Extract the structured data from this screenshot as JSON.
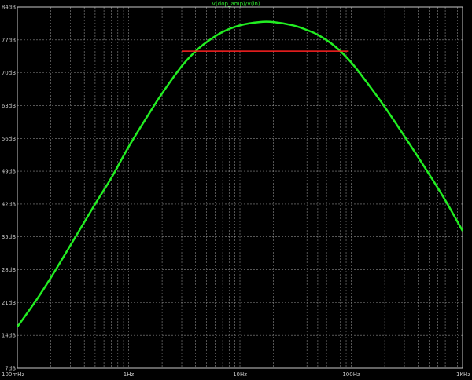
{
  "chart_data": {
    "type": "line",
    "title": "V(dop_amp)/V(in)",
    "x_scale": "log",
    "xlim": [
      0.1,
      1000
    ],
    "ylim": [
      7,
      84
    ],
    "x_ticks": [
      {
        "value": 0.1,
        "label": "100mHz"
      },
      {
        "value": 1,
        "label": "1Hz"
      },
      {
        "value": 10,
        "label": "10Hz"
      },
      {
        "value": 100,
        "label": "100Hz"
      },
      {
        "value": 1000,
        "label": "1KHz"
      }
    ],
    "y_ticks": [
      {
        "value": 84,
        "label": "84dB"
      },
      {
        "value": 77,
        "label": "77dB"
      },
      {
        "value": 70,
        "label": "70dB"
      },
      {
        "value": 63,
        "label": "63dB"
      },
      {
        "value": 56,
        "label": "56dB"
      },
      {
        "value": 49,
        "label": "49dB"
      },
      {
        "value": 42,
        "label": "42dB"
      },
      {
        "value": 35,
        "label": "35dB"
      },
      {
        "value": 28,
        "label": "28dB"
      },
      {
        "value": 21,
        "label": "21dB"
      },
      {
        "value": 14,
        "label": "14dB"
      },
      {
        "value": 7,
        "label": "7dB"
      }
    ],
    "grid": true,
    "series": [
      {
        "name": "V(dop_amp)/V(in)",
        "color": "#22ee22",
        "points": [
          [
            0.1,
            15.8
          ],
          [
            0.15,
            21.7
          ],
          [
            0.2,
            26.3
          ],
          [
            0.3,
            33.2
          ],
          [
            0.5,
            42.0
          ],
          [
            0.7,
            47.6
          ],
          [
            1,
            54.2
          ],
          [
            1.5,
            61.0
          ],
          [
            2,
            65.6
          ],
          [
            3,
            71.4
          ],
          [
            4,
            74.6
          ],
          [
            5,
            76.5
          ],
          [
            7,
            78.7
          ],
          [
            10,
            80.1
          ],
          [
            15,
            80.8
          ],
          [
            20,
            80.8
          ],
          [
            30,
            80.1
          ],
          [
            40,
            79.1
          ],
          [
            50,
            78.1
          ],
          [
            70,
            75.8
          ],
          [
            100,
            72.2
          ],
          [
            150,
            66.8
          ],
          [
            200,
            62.7
          ],
          [
            300,
            56.5
          ],
          [
            500,
            48.4
          ],
          [
            700,
            42.8
          ],
          [
            1000,
            36.3
          ]
        ]
      },
      {
        "color": "#ff2020",
        "points": [
          [
            3,
            74.6
          ],
          [
            95,
            74.6
          ]
        ]
      }
    ]
  }
}
